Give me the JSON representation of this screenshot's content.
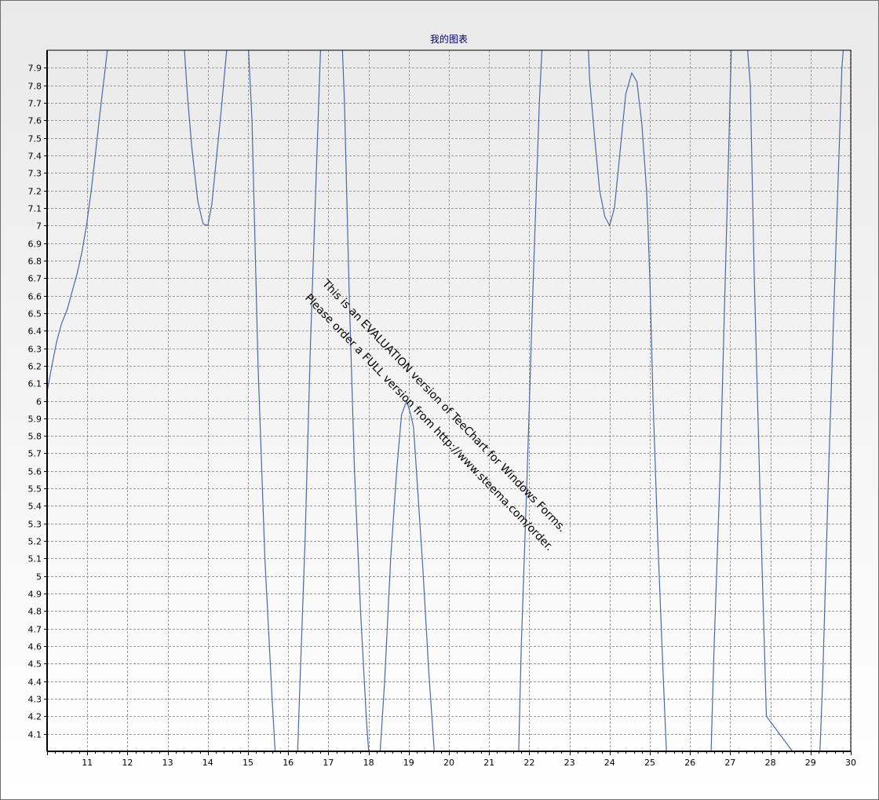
{
  "chart_data": {
    "type": "line",
    "title": "我的图表",
    "xlabel": "",
    "ylabel": "",
    "xlim": [
      10,
      30
    ],
    "ylim": [
      4,
      8
    ],
    "x_ticks": [
      11,
      12,
      13,
      14,
      15,
      16,
      17,
      18,
      19,
      20,
      21,
      22,
      23,
      24,
      25,
      26,
      27,
      28,
      29,
      30
    ],
    "y_ticks": [
      4.1,
      4.2,
      4.3,
      4.4,
      4.5,
      4.6,
      4.7,
      4.8,
      4.9,
      5,
      5.1,
      5.2,
      5.3,
      5.4,
      5.5,
      5.6,
      5.7,
      5.8,
      5.9,
      6,
      6.1,
      6.2,
      6.3,
      6.4,
      6.5,
      6.6,
      6.7,
      6.8,
      6.9,
      7,
      7.1,
      7.2,
      7.3,
      7.4,
      7.5,
      7.6,
      7.7,
      7.8,
      7.9
    ],
    "grid": true,
    "grid_style": "dashed",
    "series": [
      {
        "color": "#4a6aa5",
        "x": [
          10.0,
          10.12,
          10.24,
          10.36,
          10.5,
          10.62,
          10.74,
          10.86,
          10.98,
          11.1,
          11.2,
          11.32,
          11.45,
          11.6,
          13.3,
          13.5,
          13.6,
          13.75,
          13.88,
          14.0,
          14.1,
          14.2,
          14.33,
          14.45,
          14.6,
          14.95,
          15.1,
          15.25,
          15.42,
          15.6,
          15.75,
          16.2,
          16.28,
          16.42,
          16.55,
          16.7,
          16.85,
          17.3,
          17.4,
          17.52,
          17.65,
          17.8,
          17.95,
          18.05,
          18.25,
          18.4,
          18.55,
          18.7,
          18.82,
          18.95,
          19.05,
          19.12,
          19.22,
          19.35,
          19.5,
          19.65,
          19.75,
          21.7,
          21.8,
          21.95,
          22.1,
          22.25,
          22.4,
          23.4,
          23.5,
          23.62,
          23.75,
          23.88,
          24.0,
          24.12,
          24.25,
          24.4,
          24.55,
          24.68,
          24.8,
          24.92,
          25.0,
          25.08,
          25.2,
          25.32,
          25.45,
          26.5,
          26.6,
          26.75,
          26.9,
          27.05,
          27.3,
          27.5,
          27.6,
          27.75,
          27.9,
          29.2,
          29.3,
          29.45,
          29.62,
          29.78,
          29.95,
          30.0
        ],
        "y": [
          6.05,
          6.2,
          6.34,
          6.44,
          6.52,
          6.62,
          6.72,
          6.84,
          7.0,
          7.2,
          7.4,
          7.65,
          7.9,
          8.2,
          8.4,
          7.72,
          7.45,
          7.14,
          7.01,
          7.0,
          7.12,
          7.35,
          7.65,
          7.95,
          8.3,
          8.3,
          7.6,
          6.2,
          5.1,
          4.3,
          3.7,
          3.75,
          4.3,
          5.2,
          6.3,
          7.3,
          8.3,
          8.3,
          7.7,
          6.6,
          5.6,
          4.8,
          4.17,
          3.85,
          3.86,
          4.4,
          5.1,
          5.6,
          5.92,
          6.0,
          5.92,
          5.85,
          5.5,
          5.05,
          4.45,
          3.95,
          3.65,
          3.65,
          4.6,
          5.6,
          6.7,
          7.7,
          8.4,
          8.4,
          7.84,
          7.52,
          7.2,
          7.05,
          7.0,
          7.1,
          7.4,
          7.75,
          7.87,
          7.82,
          7.58,
          7.2,
          6.7,
          6.0,
          5.2,
          4.5,
          3.8,
          3.8,
          4.6,
          5.6,
          6.9,
          8.2,
          8.4,
          7.8,
          6.7,
          5.4,
          4.2,
          3.8,
          4.4,
          5.6,
          6.8,
          7.9,
          8.4,
          8.4
        ]
      }
    ]
  },
  "watermark": {
    "line1": "This is an EVALUATION version of TeeChart for Windows Forms.",
    "line2": "Please order a FULL version from http://www.steema.com/order."
  }
}
